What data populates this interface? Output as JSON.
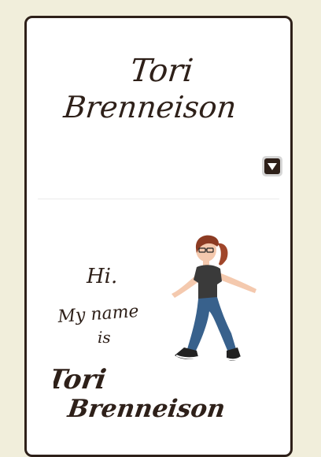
{
  "site": {
    "logo_line1": "Tori",
    "logo_line2": "Brenneison"
  },
  "header": {
    "menu_icon": "chevron-down-icon"
  },
  "intro": {
    "greeting": "Hi.",
    "my_name_is_1": "My name",
    "my_name_is_2": "is",
    "name_line1": "Tori",
    "name_line2": "Brenneison"
  },
  "colors": {
    "background": "#f1eedb",
    "card": "#ffffff",
    "ink": "#2e2019",
    "button": "#d6d6d6"
  }
}
